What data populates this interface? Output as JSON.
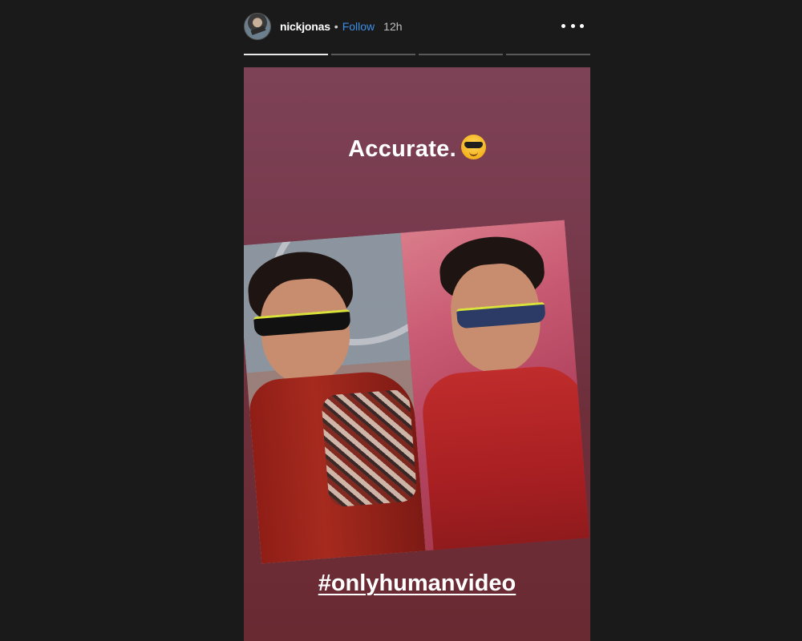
{
  "header": {
    "username": "nickjonas",
    "separator": "•",
    "follow_label": "Follow",
    "timestamp": "12h",
    "avatar_icon": "avatar-icon",
    "more_icon": "more-options-icon"
  },
  "progress": {
    "segments": 4,
    "current_segment": 1,
    "current_fill_fraction": 1.0
  },
  "story": {
    "caption": "Accurate.",
    "caption_emoji": "sunglasses-emoji-icon",
    "hashtag": "#onlyhumanvideo"
  },
  "colors": {
    "accent_follow": "#3b8fe6",
    "background": "#1a1a1a",
    "story_top": "#7e4257",
    "story_bottom": "#6a2a32"
  }
}
